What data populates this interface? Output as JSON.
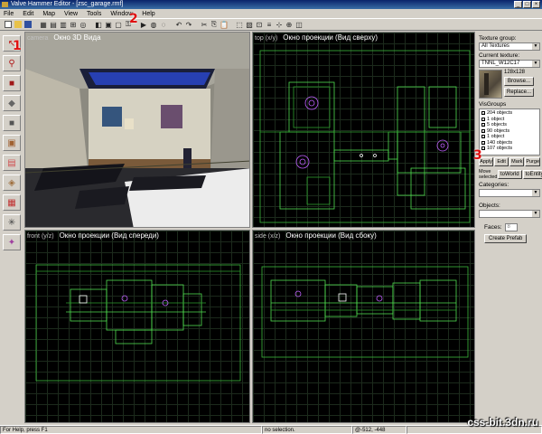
{
  "window": {
    "title": "Valve Hammer Editor - [zsc_garage.rmf]",
    "controls": [
      "_",
      "□",
      "×"
    ]
  },
  "menu": [
    "File",
    "Edit",
    "Map",
    "View",
    "Tools",
    "Window",
    "Help"
  ],
  "viewports": {
    "camera": {
      "tag": "camera",
      "title": "Окно 3D Вида"
    },
    "top": {
      "tag": "top (x/y)",
      "title": "Окно проекции (Вид сверху)"
    },
    "front": {
      "tag": "front (y/z)",
      "title": "Окно проекции (Вид спереди)"
    },
    "side": {
      "tag": "side (x/z)",
      "title": "Окно проекции (Вид сбоку)"
    }
  },
  "right_panel": {
    "texture_group_label": "Texture group:",
    "texture_group_value": "All Textures",
    "current_texture_label": "Current texture:",
    "current_texture_value": "TNNL_W12C17",
    "texture_size": "128x128",
    "browse_button": "Browse...",
    "replace_button": "Replace...",
    "visgroups_label": "VisGroups",
    "visgroups": [
      "204 objects",
      "1 object",
      "5 objects",
      "90 objects",
      "1 object",
      "140 objects",
      "107 objects"
    ],
    "apply_button": "Apply",
    "edit_button": "Edit",
    "mark_button": "Mark",
    "purge_button": "Purge",
    "move_selected_label": "Move selected:",
    "to_world_button": "toWorld",
    "to_entity_button": "toEntity",
    "categories_label": "Categories:",
    "objects_label": "Objects:",
    "faces_label": "Faces:",
    "faces_value": "8",
    "create_prefab_button": "Create Prefab"
  },
  "status": {
    "help": "For Help, press F1",
    "selection": "no selection.",
    "coords": "@-512, -448",
    "extra": "css-bit.3dn.ru"
  },
  "callouts": [
    "1",
    "2",
    "3"
  ],
  "colors": {
    "wireframe": "#4fdc4f",
    "entity": "#c060ff",
    "grid": "#1c2a1c"
  }
}
